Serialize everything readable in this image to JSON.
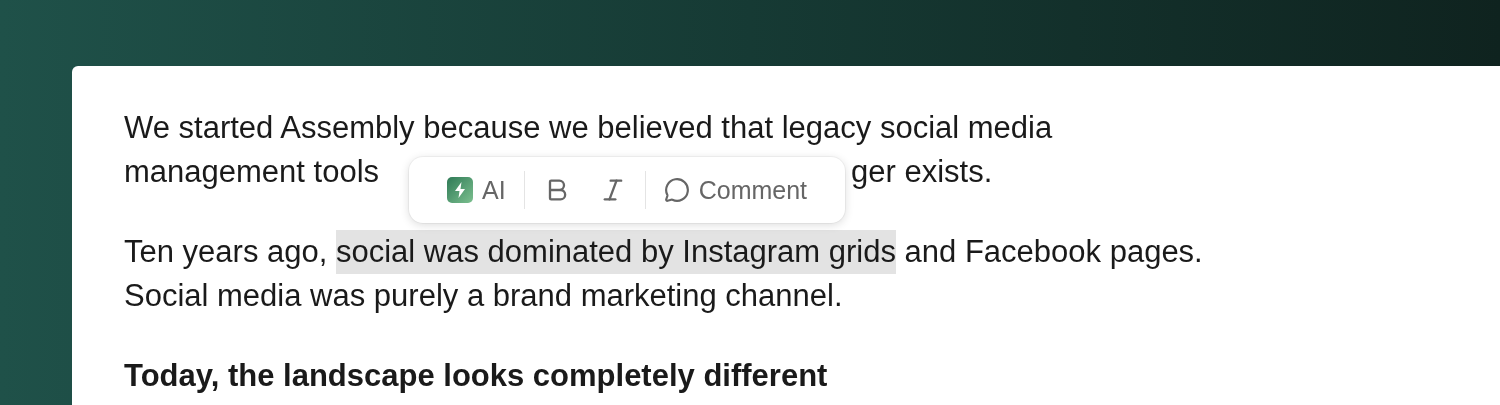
{
  "toolbar": {
    "ai_label": "AI",
    "comment_label": "Comment"
  },
  "paragraphs": [
    {
      "bold": false,
      "lines": [
        [
          {
            "kind": "text",
            "text": "We started Assembly because we believed that legacy social media",
            "highlighted": false
          }
        ],
        [
          {
            "kind": "text",
            "text": "management tools",
            "highlighted": false
          },
          {
            "kind": "toolbar"
          },
          {
            "kind": "text",
            "text": "ger exists.",
            "highlighted": false
          }
        ]
      ]
    },
    {
      "bold": false,
      "lines": [
        [
          {
            "kind": "text",
            "text": "Ten years ago, ",
            "highlighted": false
          },
          {
            "kind": "text",
            "text": "social was dominated by Instagram grids",
            "highlighted": true
          },
          {
            "kind": "text",
            "text": " and Facebook pages.",
            "highlighted": false
          }
        ],
        [
          {
            "kind": "text",
            "text": "Social media was purely a brand marketing channel.",
            "highlighted": false
          }
        ]
      ]
    },
    {
      "bold": true,
      "lines": [
        [
          {
            "kind": "text",
            "text": "Today, the landscape looks completely different",
            "highlighted": false
          }
        ]
      ]
    }
  ]
}
